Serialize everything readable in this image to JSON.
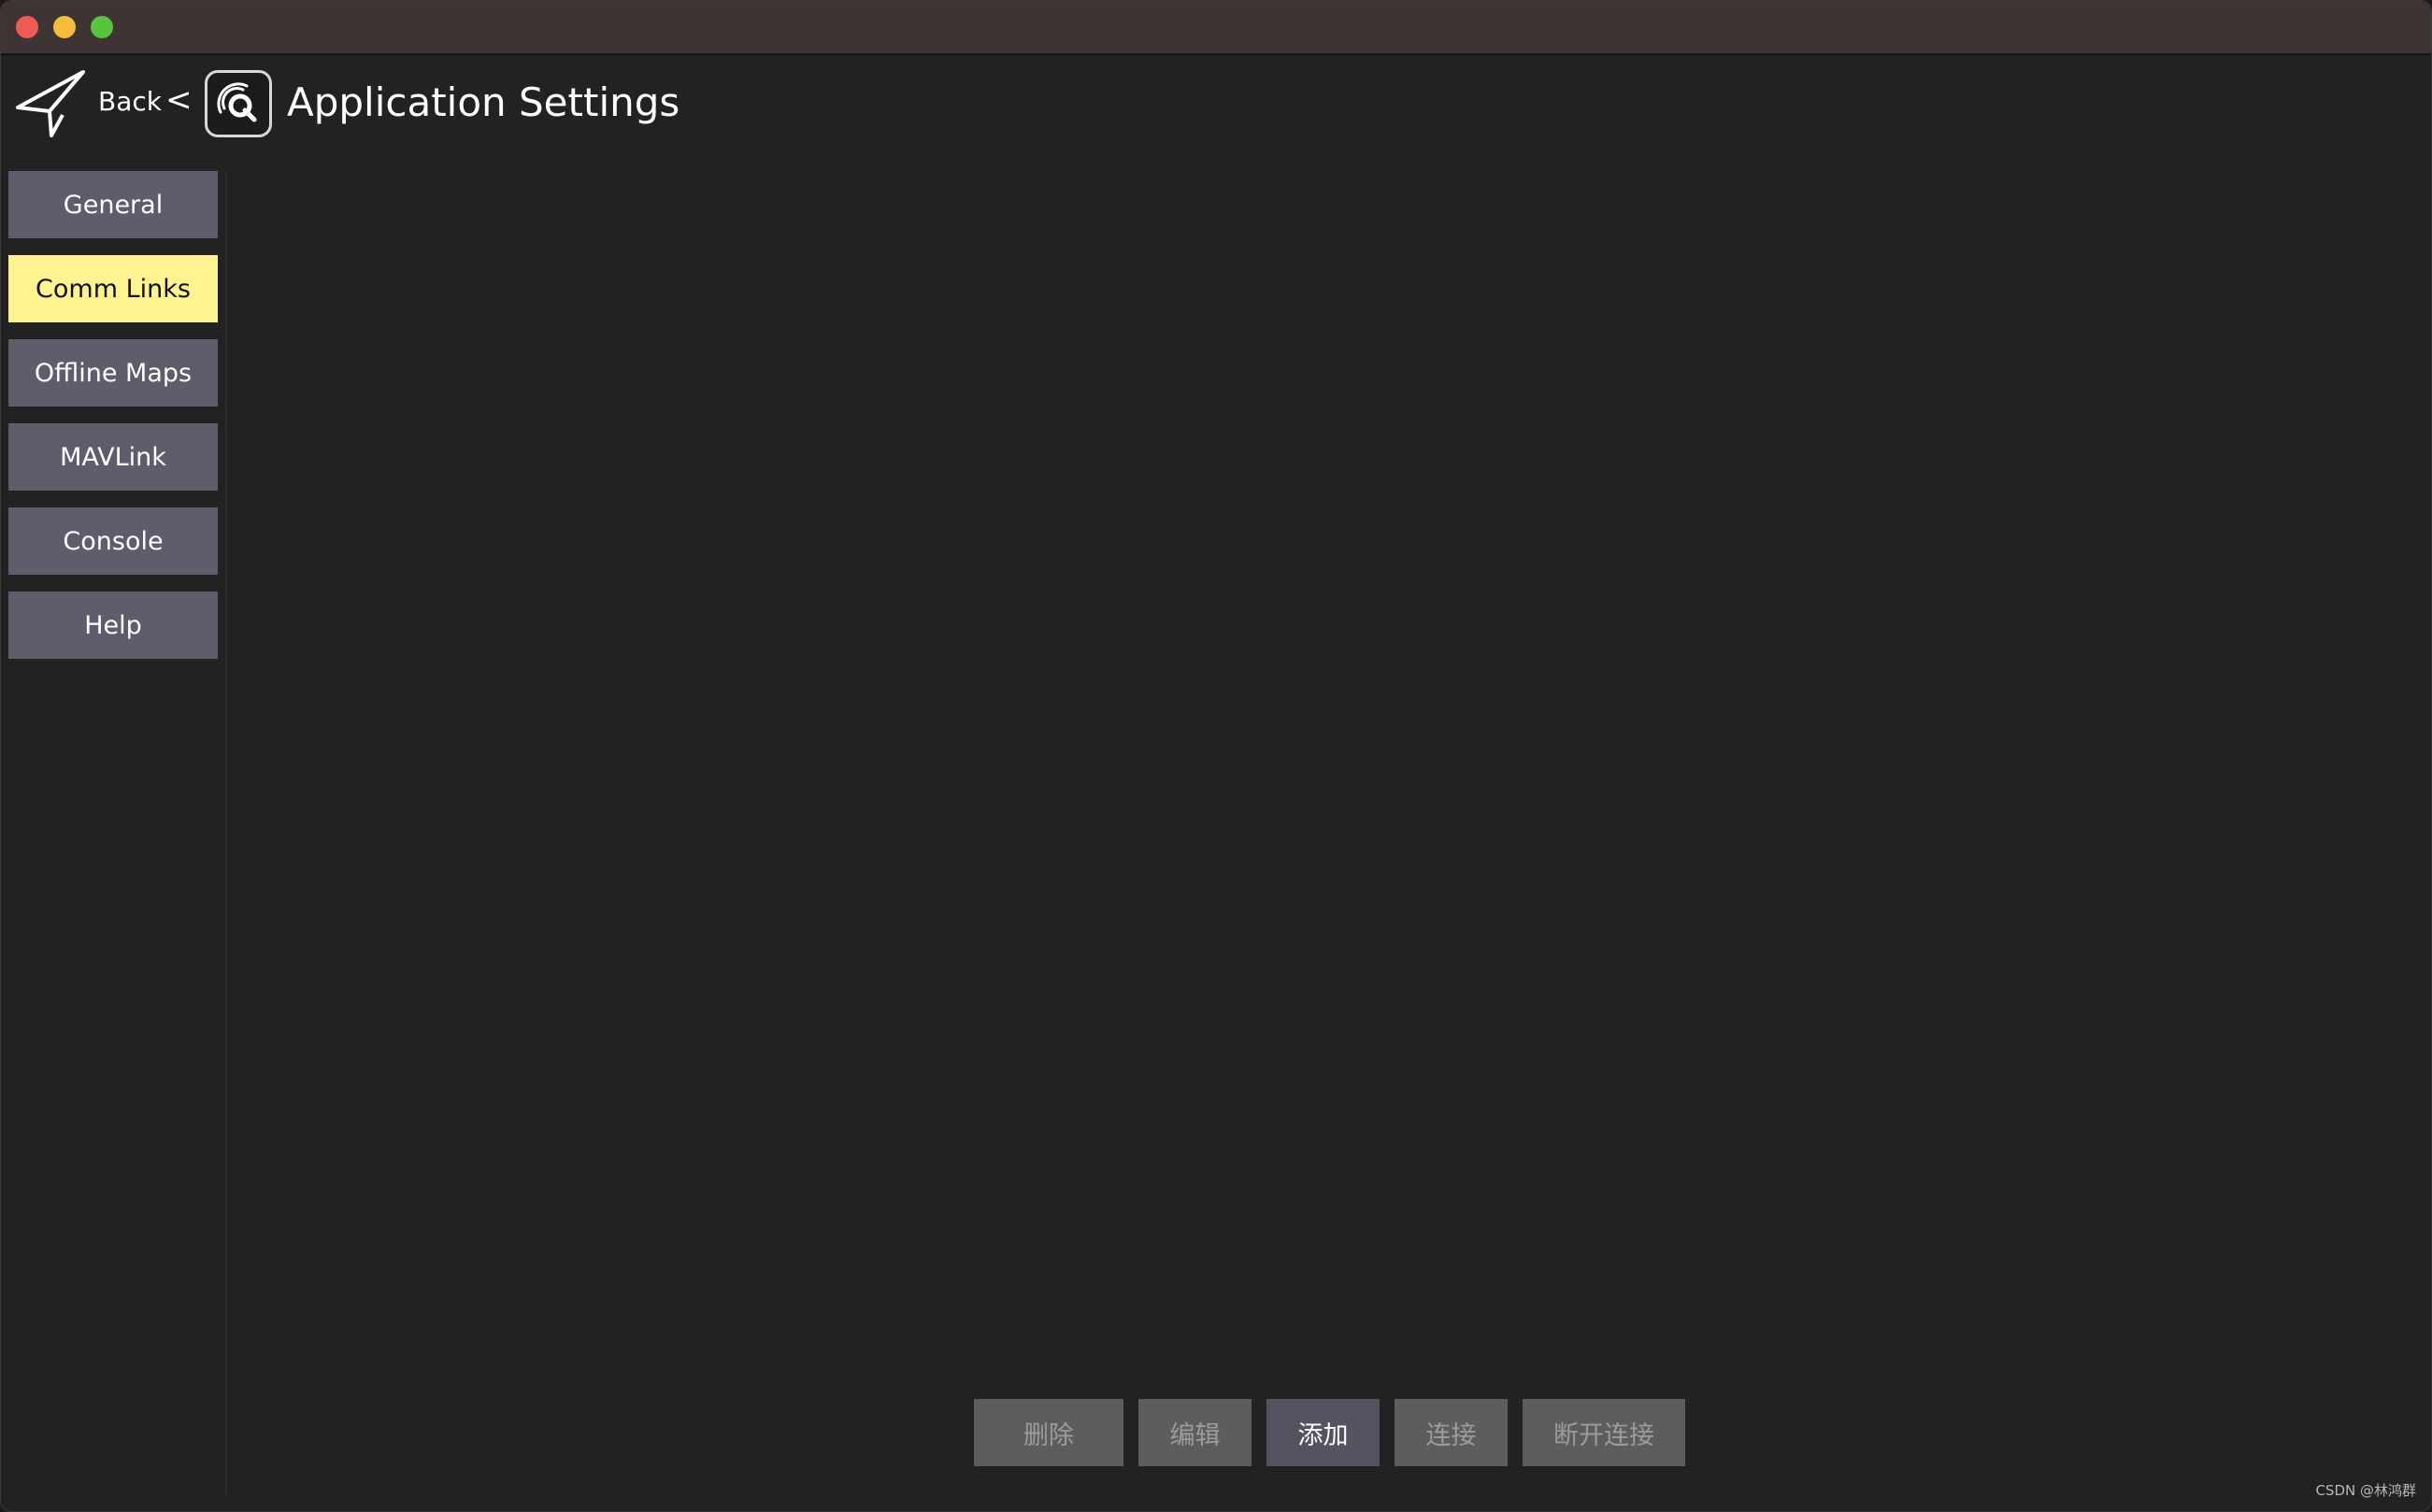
{
  "header": {
    "back_label": "Back",
    "separator": "<",
    "title": "Application Settings"
  },
  "sidebar": {
    "items": [
      {
        "label": "General",
        "active": false
      },
      {
        "label": "Comm Links",
        "active": true
      },
      {
        "label": "Offline Maps",
        "active": false
      },
      {
        "label": "MAVLink",
        "active": false
      },
      {
        "label": "Console",
        "active": false
      },
      {
        "label": "Help",
        "active": false
      }
    ]
  },
  "actions": {
    "delete": {
      "label": "删除",
      "enabled": false
    },
    "edit": {
      "label": "编辑",
      "enabled": false
    },
    "add": {
      "label": "添加",
      "enabled": true
    },
    "connect": {
      "label": "连接",
      "enabled": false
    },
    "disconnect": {
      "label": "断开连接",
      "enabled": false
    }
  },
  "watermark": "CSDN @林鸿群",
  "colors": {
    "active_nav": "#fff291",
    "nav_button": "#5e5d6b",
    "background": "#222222",
    "primary_action": "#54535f",
    "disabled_action": "#5e5d5d"
  },
  "icons": {
    "back": "paper-plane-icon",
    "app": "qgc-logo-icon"
  }
}
